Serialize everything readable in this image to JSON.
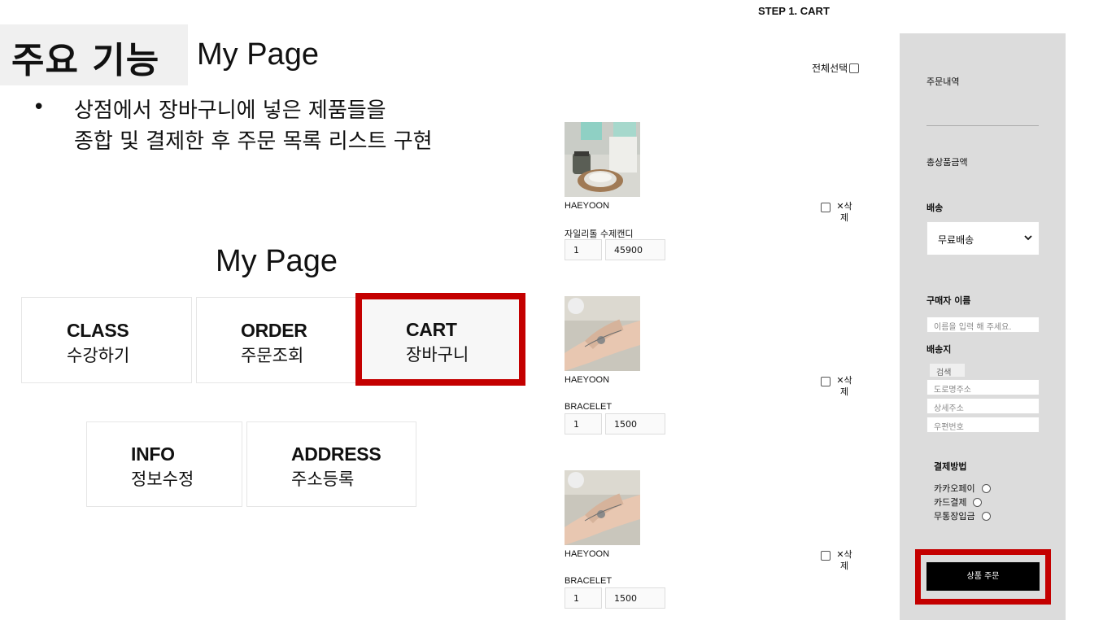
{
  "slide": {
    "title_main": "주요 기능",
    "title_sub": "My Page",
    "bullet_symbol": "•",
    "bullet_line1": "상점에서 장바구니에 넣은 제품들을",
    "bullet_line2": "종합 및 결제한 후 주문 목록 리스트 구현",
    "mypage_heading": "My Page",
    "menu": [
      {
        "en": "CLASS",
        "ko": "수강하기"
      },
      {
        "en": "ORDER",
        "ko": "주문조회"
      },
      {
        "en": "CART",
        "ko": "장바구니"
      },
      {
        "en": "INFO",
        "ko": "정보수정"
      },
      {
        "en": "ADDRESS",
        "ko": "주소등록"
      }
    ],
    "highlight_color": "#c40000"
  },
  "cart": {
    "step_title": "STEP 1. CART",
    "select_all_label": "전체선택",
    "delete_label": "✕삭제",
    "items": [
      {
        "brand": "HAEYOON",
        "name": "자일리톨 수제캔디",
        "qty": "1",
        "price": "45900"
      },
      {
        "brand": "HAEYOON",
        "name": "BRACELET",
        "qty": "1",
        "price": "1500"
      },
      {
        "brand": "HAEYOON",
        "name": "BRACELET",
        "qty": "1",
        "price": "1500"
      }
    ]
  },
  "sidebar": {
    "order_history_label": "주문내역",
    "total_label": "총상품금액",
    "shipping_label": "배송",
    "shipping_selected": "무료배송",
    "buyer_label": "구매자 이름",
    "buyer_placeholder": "이름을 입력 해 주세요.",
    "address_label": "배송지",
    "search_button": "검색",
    "road_address_placeholder": "도로명주소",
    "detail_address_placeholder": "상세주소",
    "postal_code_placeholder": "우편번호",
    "payment_label": "결제방법",
    "payment_options": [
      "카카오페이",
      "카드결제",
      "무통장입금"
    ],
    "order_button": "상품 주문"
  }
}
